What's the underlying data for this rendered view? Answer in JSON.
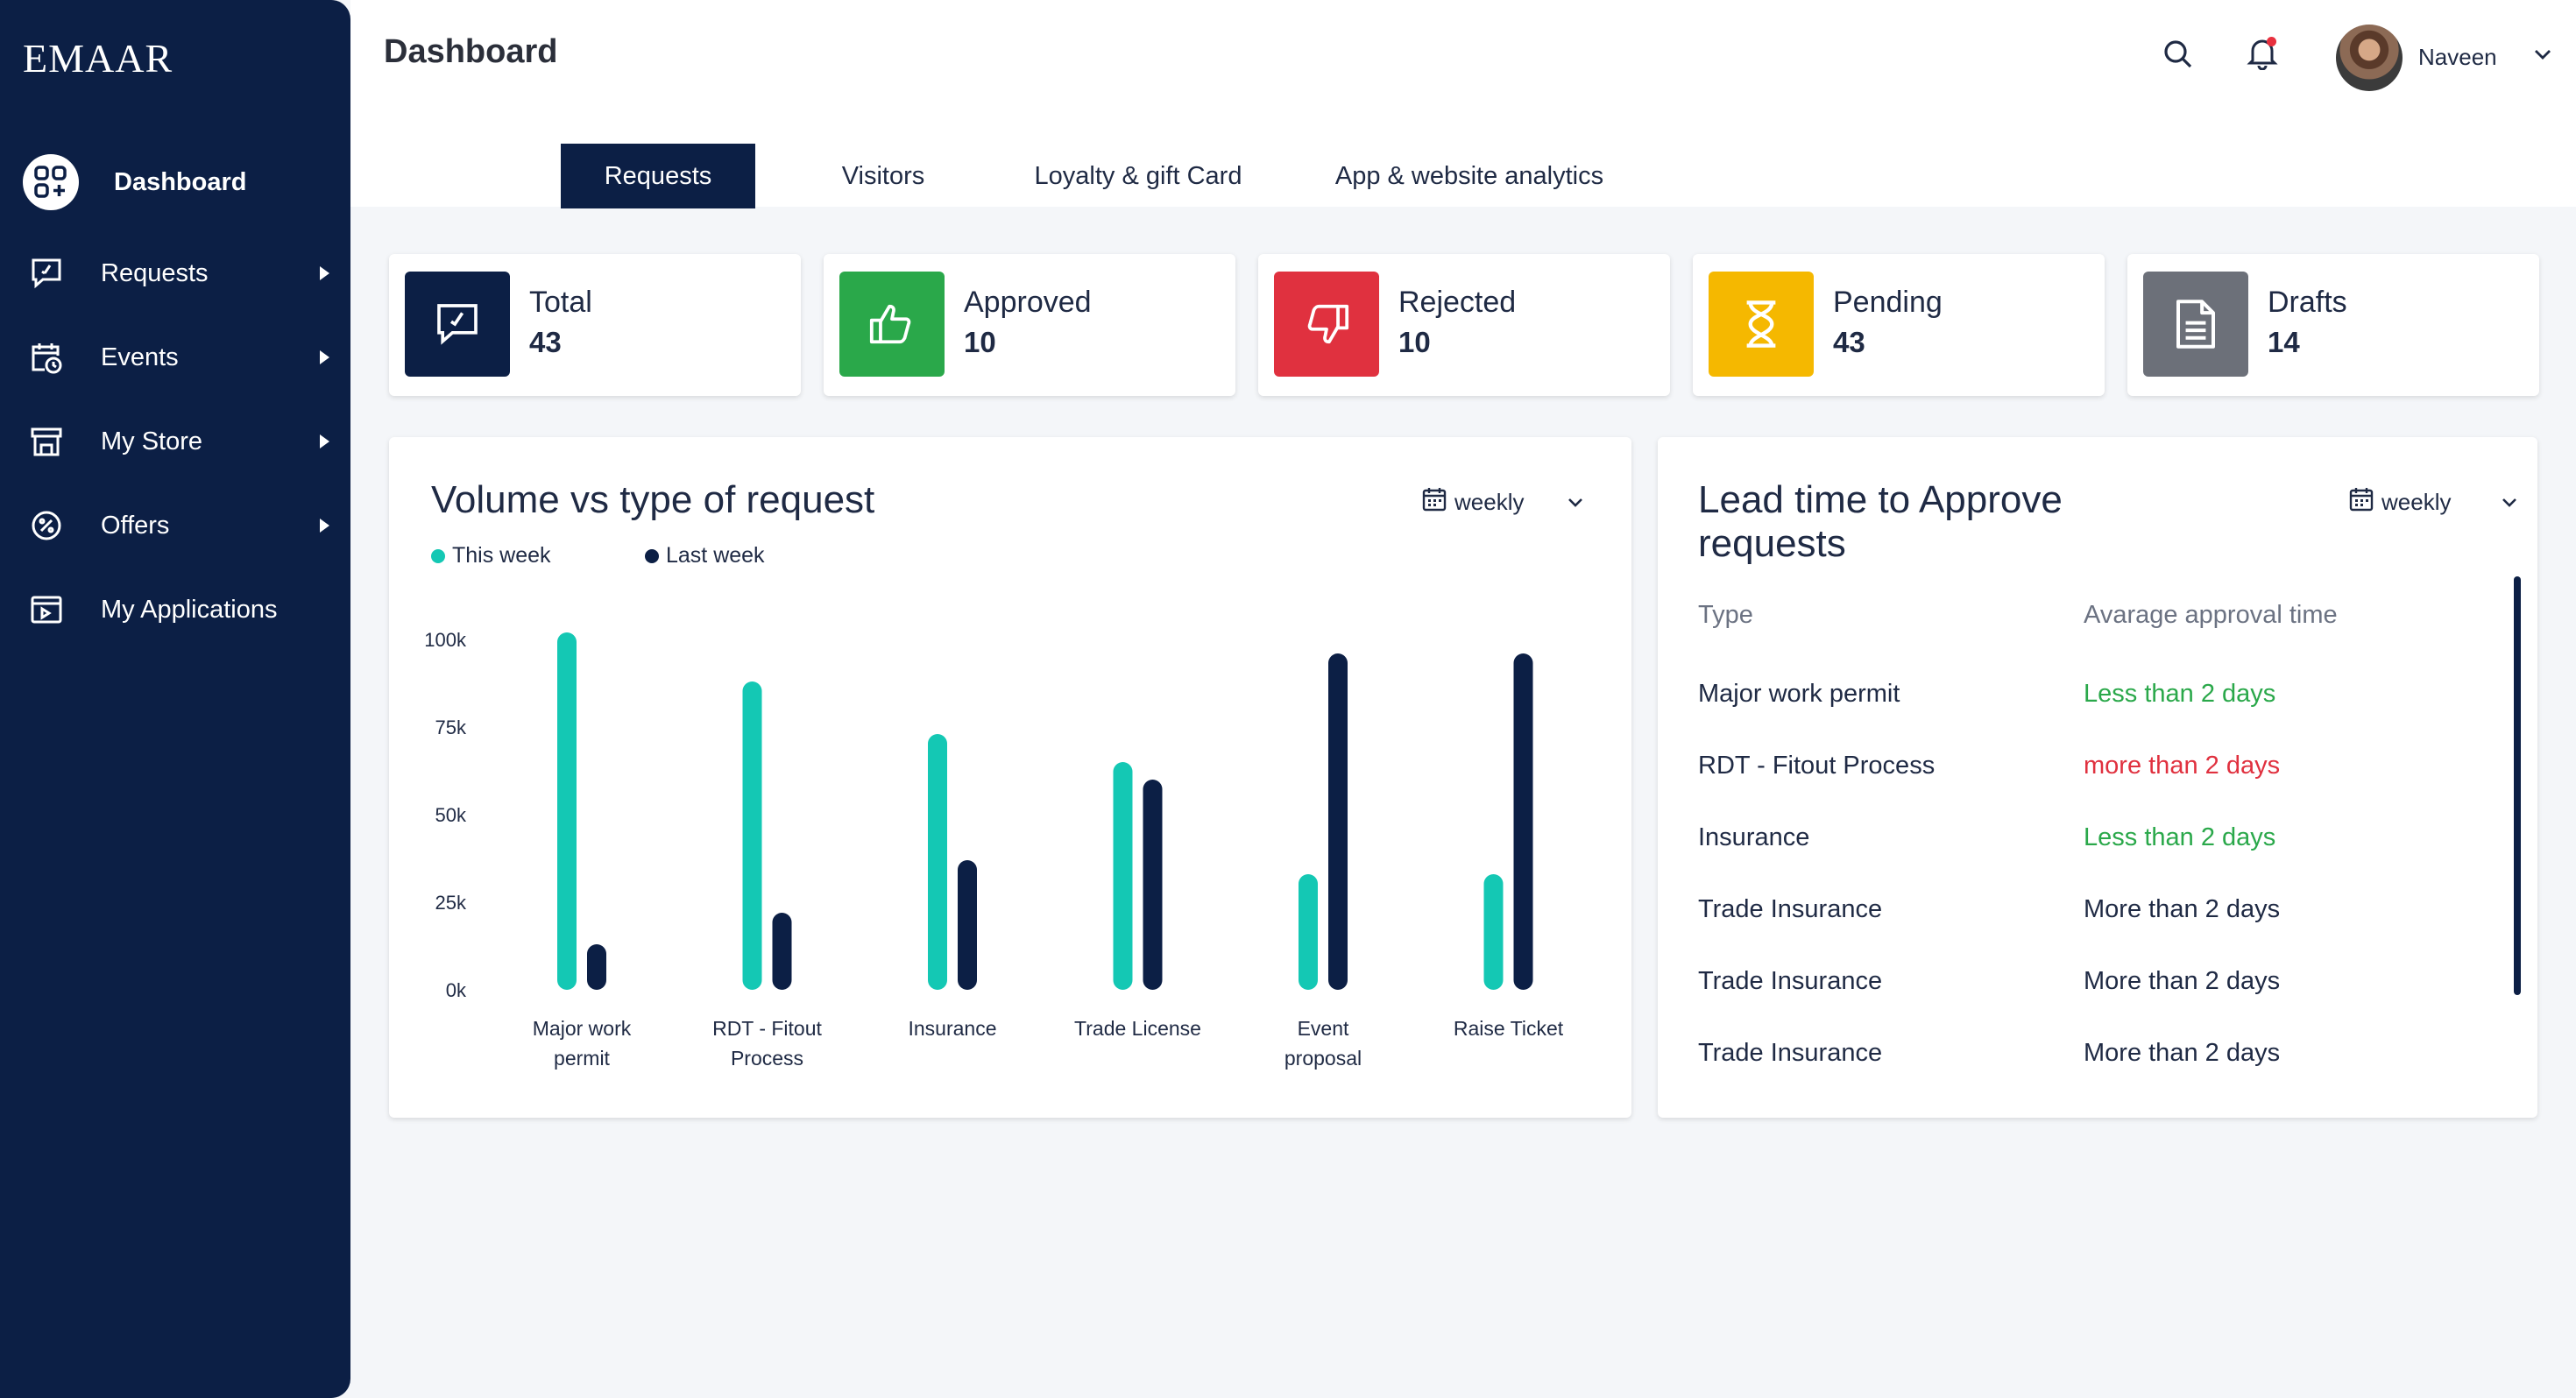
{
  "brand": {
    "logo_text": "EMAAR"
  },
  "sidebar": {
    "items": [
      {
        "label": "Dashboard",
        "icon": "dashboard-grid-icon",
        "active": true,
        "has_submenu": false
      },
      {
        "label": "Requests",
        "icon": "request-chat-icon",
        "active": false,
        "has_submenu": true
      },
      {
        "label": "Events",
        "icon": "calendar-clock-icon",
        "active": false,
        "has_submenu": true
      },
      {
        "label": "My Store",
        "icon": "store-icon",
        "active": false,
        "has_submenu": true
      },
      {
        "label": "Offers",
        "icon": "discount-badge-icon",
        "active": false,
        "has_submenu": true
      },
      {
        "label": "My Applications",
        "icon": "application-window-icon",
        "active": false,
        "has_submenu": false
      }
    ]
  },
  "header": {
    "title": "Dashboard",
    "user": {
      "name": "Naveen"
    },
    "icons": [
      "search-icon",
      "bell-icon"
    ]
  },
  "tabs": [
    {
      "label": "Requests",
      "active": true
    },
    {
      "label": "Visitors",
      "active": false
    },
    {
      "label": "Loyalty & gift Card",
      "active": false
    },
    {
      "label": "App & website analytics",
      "active": false
    }
  ],
  "stats": [
    {
      "label": "Total",
      "value": "43",
      "color": "#0c1f45",
      "icon": "request-chat-icon"
    },
    {
      "label": "Approved",
      "value": "10",
      "color": "#2aa84a",
      "icon": "thumbs-up-icon"
    },
    {
      "label": "Rejected",
      "value": "10",
      "color": "#e0313f",
      "icon": "thumbs-down-icon"
    },
    {
      "label": "Pending",
      "value": "43",
      "color": "#f5b800",
      "icon": "hourglass-icon"
    },
    {
      "label": "Drafts",
      "value": "14",
      "color": "#6c7079",
      "icon": "document-icon"
    }
  ],
  "volume_panel": {
    "title": "Volume vs type of request",
    "period": "weekly"
  },
  "lead_panel": {
    "title_line1": "Lead time to Approve",
    "title_line2": "requests",
    "period": "weekly",
    "col_type": "Type",
    "col_time": "Avarage approval time",
    "rows": [
      {
        "type": "Major work permit",
        "time": "Less than 2 days",
        "color": "#2aa84a"
      },
      {
        "type": "RDT - Fitout Process",
        "time": "more than 2 days",
        "color": "#e0313f"
      },
      {
        "type": "Insurance",
        "time": "Less than 2 days",
        "color": "#2aa84a"
      },
      {
        "type": "Trade Insurance",
        "time": "More than 2 days",
        "color": "#1f2a44"
      },
      {
        "type": "Trade Insurance",
        "time": "More than 2 days",
        "color": "#1f2a44"
      },
      {
        "type": "Trade Insurance",
        "time": "More than 2 days",
        "color": "#1f2a44"
      }
    ]
  },
  "chart_data": {
    "type": "bar",
    "title": "Volume vs type of request",
    "categories": [
      [
        "Major work",
        "permit"
      ],
      [
        "RDT - Fitout",
        "Process"
      ],
      [
        "Insurance"
      ],
      [
        "Trade License"
      ],
      [
        "Event",
        "proposal"
      ],
      [
        "Raise Ticket"
      ]
    ],
    "series": [
      {
        "name": "This week",
        "color": "#14c8b4",
        "values": [
          102000,
          88000,
          73000,
          65000,
          33000,
          33000
        ]
      },
      {
        "name": "Last week",
        "color": "#0c1f45",
        "values": [
          13000,
          22000,
          37000,
          60000,
          96000,
          96000
        ]
      }
    ],
    "yticks": [
      "100k",
      "75k",
      "50k",
      "25k",
      "0k"
    ],
    "ylim": [
      0,
      100000
    ],
    "legend_position": "top-left"
  }
}
